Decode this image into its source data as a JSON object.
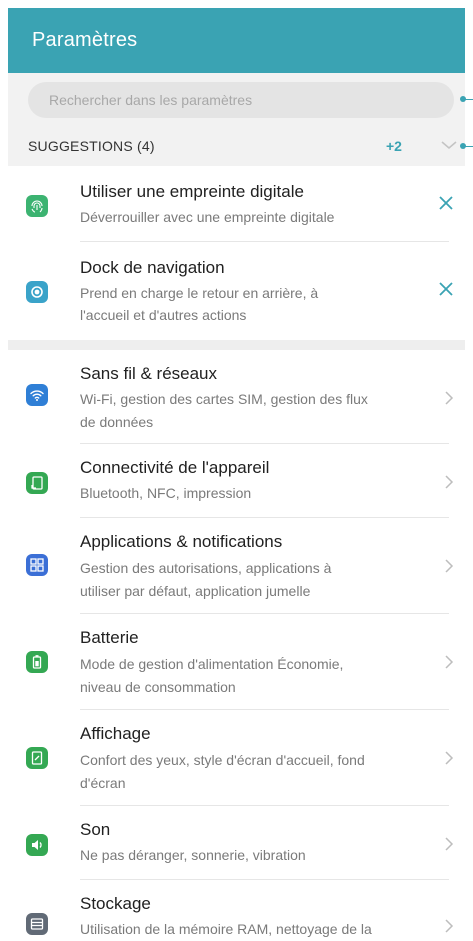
{
  "appbar": {
    "title": "Paramètres"
  },
  "search": {
    "placeholder": "Rechercher dans les paramètres"
  },
  "suggestions": {
    "title": "SUGGESTIONS (4)",
    "more_count": "+2",
    "items": [
      {
        "title": "Utiliser une empreinte digitale",
        "subtitle": "Déverrouiller avec une empreinte digitale",
        "icon": "fingerprint-icon",
        "color": "#3cb371"
      },
      {
        "title": "Dock de navigation",
        "subtitle_line1": "Prend en charge le retour en arrière, à",
        "subtitle_line2": "l'accueil et d'autres actions",
        "icon": "navigation-dock-icon",
        "color": "#3aa3c9"
      }
    ]
  },
  "settings": {
    "items": [
      {
        "title": "Sans fil & réseaux",
        "subtitle_line1": "Wi-Fi, gestion des cartes SIM, gestion des flux",
        "subtitle_line2": "de données",
        "icon": "wifi-icon",
        "color": "#2f7fd6"
      },
      {
        "title": "Connectivité de l'appareil",
        "subtitle_line1": "Bluetooth, NFC, impression",
        "icon": "device-connectivity-icon",
        "color": "#34a853"
      },
      {
        "title": "Applications & notifications",
        "subtitle_line1": "Gestion des autorisations, applications à",
        "subtitle_line2": "utiliser par défaut, application jumelle",
        "icon": "apps-grid-icon",
        "color": "#3b6fd6"
      },
      {
        "title": "Batterie",
        "subtitle_line1": "Mode de gestion d'alimentation Économie,",
        "subtitle_line2": "niveau de consommation",
        "icon": "battery-icon",
        "color": "#34a853"
      },
      {
        "title": "Affichage",
        "subtitle_line1": "Confort des yeux, style d'écran d'accueil, fond",
        "subtitle_line2": "d'écran",
        "icon": "display-icon",
        "color": "#34a853"
      },
      {
        "title": "Son",
        "subtitle_line1": "Ne pas déranger, sonnerie, vibration",
        "icon": "speaker-icon",
        "color": "#34a853"
      },
      {
        "title": "Stockage",
        "subtitle_line1": "Utilisation de la mémoire RAM, nettoyage de la",
        "icon": "storage-icon",
        "color": "#616a76"
      }
    ]
  }
}
